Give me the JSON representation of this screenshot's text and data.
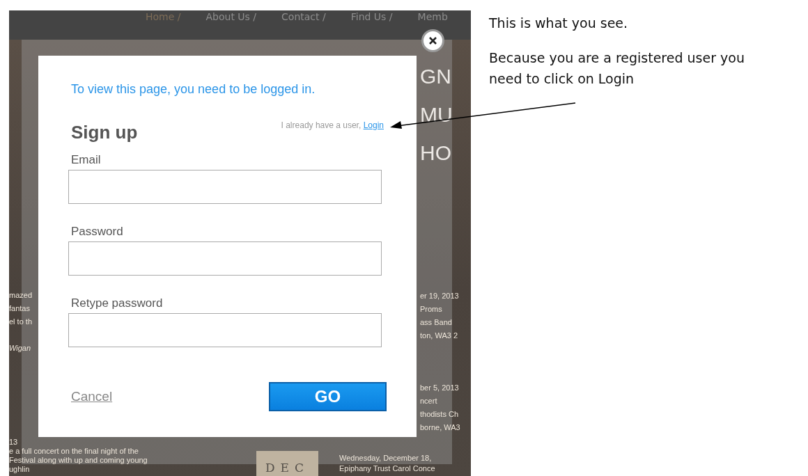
{
  "site": {
    "nav": [
      "Home /",
      "About Us /",
      "Contact /",
      "Find Us /",
      "Memb"
    ],
    "hero_letters": [
      "GN",
      "MU",
      "HO"
    ],
    "fragments": [
      {
        "text": "mazed"
      },
      {
        "text": "fantas"
      },
      {
        "text": "el to th"
      },
      {
        "text": "Wigan"
      },
      {
        "text": "13"
      },
      {
        "text": "e a full concert on the final night of the"
      },
      {
        "text": "Festival along with up and coming young"
      },
      {
        "text": "ughlin"
      },
      {
        "text": "er 19, 2013"
      },
      {
        "text": "Proms"
      },
      {
        "text": "ass Band"
      },
      {
        "text": "ton, WA3 2"
      },
      {
        "text": "ber 5, 2013"
      },
      {
        "text": "ncert"
      },
      {
        "text": "thodists Ch"
      },
      {
        "text": "borne, WA3"
      },
      {
        "text": "DEC"
      },
      {
        "text": "Wednesday, December 18,"
      },
      {
        "text": "Epiphany Trust Carol Conce"
      }
    ]
  },
  "modal": {
    "message": "To view this page, you need to be logged in.",
    "title": "Sign up",
    "login_prompt": "I already have a user,",
    "login_link": "Login",
    "fields": [
      {
        "label": "Email"
      },
      {
        "label": "Password"
      },
      {
        "label": "Retype password"
      }
    ],
    "cancel": "Cancel",
    "submit": "GO"
  },
  "annotation": {
    "lines": [
      "This is what you see.",
      "Because you are a registered user you need to click on Login"
    ]
  }
}
